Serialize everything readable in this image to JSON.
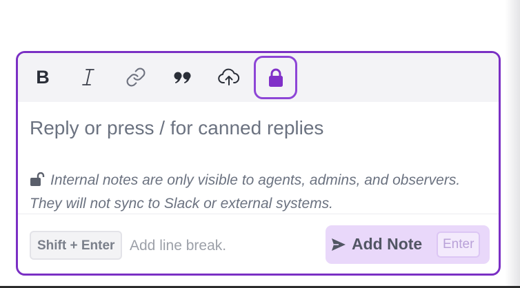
{
  "toolbar": {
    "bold_icon": "bold-icon",
    "bold_glyph": "B",
    "italic_icon": "italic-icon",
    "link_icon": "link-icon",
    "quote_icon": "quote-icon",
    "upload_icon": "cloud-upload-icon",
    "private_icon": "lock-icon",
    "private_active_color": "#8d45d6"
  },
  "editor": {
    "placeholder": "Reply or press / for canned replies"
  },
  "notice": {
    "icon": "unlock-icon",
    "text": "Internal notes are only visible to agents, admins, and observers. They will not sync to Slack or external systems."
  },
  "footer": {
    "shortcut_key": "Shift + Enter",
    "shortcut_hint": "Add line break."
  },
  "submit": {
    "icon": "send-icon",
    "label": "Add Note",
    "shortcut": "Enter",
    "background": "#e9d8fa"
  },
  "colors": {
    "accent": "#7a2fc4",
    "toolbar_bg": "#f3f3f6",
    "muted_text": "#6b7280"
  }
}
